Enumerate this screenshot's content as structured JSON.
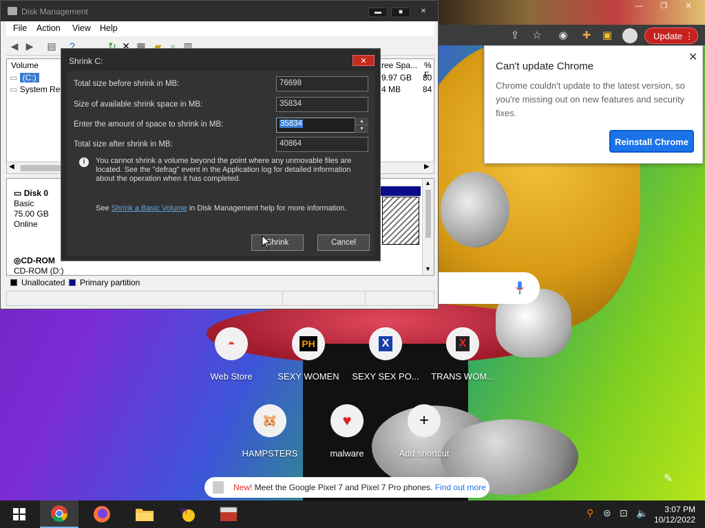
{
  "chrome": {
    "update_label": "Update",
    "popup": {
      "title": "Can't update Chrome",
      "text": "Chrome couldn't update to the latest version, so you're missing out on new features and security fixes.",
      "button": "Reinstall Chrome",
      "close": "✕"
    },
    "shortcuts": [
      {
        "label": "Web Store",
        "glyph": "◓"
      },
      {
        "label": "SEXY WOMEN",
        "glyph": "PH"
      },
      {
        "label": "SEXY SEX PO...",
        "glyph": "X"
      },
      {
        "label": "TRANS WOM...",
        "glyph": "X"
      },
      {
        "label": "HAMPSTERS",
        "glyph": "🐹"
      },
      {
        "label": "malware",
        "glyph": "♥"
      },
      {
        "label": "Add shortcut",
        "glyph": "+"
      }
    ],
    "promo": {
      "new": "New!",
      "text": " Meet the Google Pixel 7 and Pixel 7 Pro phones. ",
      "link": "Find out more"
    }
  },
  "disk_management": {
    "title": "Disk Management",
    "menus": [
      "File",
      "Action",
      "View",
      "Help"
    ],
    "columns": {
      "volume": "Volume",
      "free": "ree Spa...",
      "pct": "% F"
    },
    "volumes": [
      {
        "name": "(C:)",
        "free": "9.97 GB",
        "pct": "80"
      },
      {
        "name": "System Res",
        "free": "4 MB",
        "pct": "84"
      }
    ],
    "disk0": {
      "name": "Disk 0",
      "type": "Basic",
      "size": "75.00 GB",
      "status": "Online"
    },
    "cdrom": {
      "name": "CD-ROM",
      "drive": "CD-ROM (D:)"
    },
    "legend": {
      "unallocated": "Unallocated",
      "primary": "Primary partition"
    }
  },
  "shrink_dialog": {
    "title": "Shrink C:",
    "fields": [
      {
        "label": "Total size before shrink in MB:",
        "value": "76698"
      },
      {
        "label": "Size of available shrink space in MB:",
        "value": "35834"
      },
      {
        "label": "Enter the amount of space to shrink in MB:",
        "value": "35834"
      },
      {
        "label": "Total size after shrink in MB:",
        "value": "40864"
      }
    ],
    "info": "You cannot shrink a volume beyond the point where any unmovable files are located. See the \"defrag\" event in the Application log for detailed information about the operation when it has completed.",
    "see_prefix": "See ",
    "see_link": "Shrink a Basic Volume",
    "see_suffix": " in Disk Management help for more information.",
    "shrink_button": "Shrink",
    "cancel_button": "Cancel"
  },
  "taskbar": {
    "time": "3:07 PM",
    "date": "10/12/2022"
  }
}
